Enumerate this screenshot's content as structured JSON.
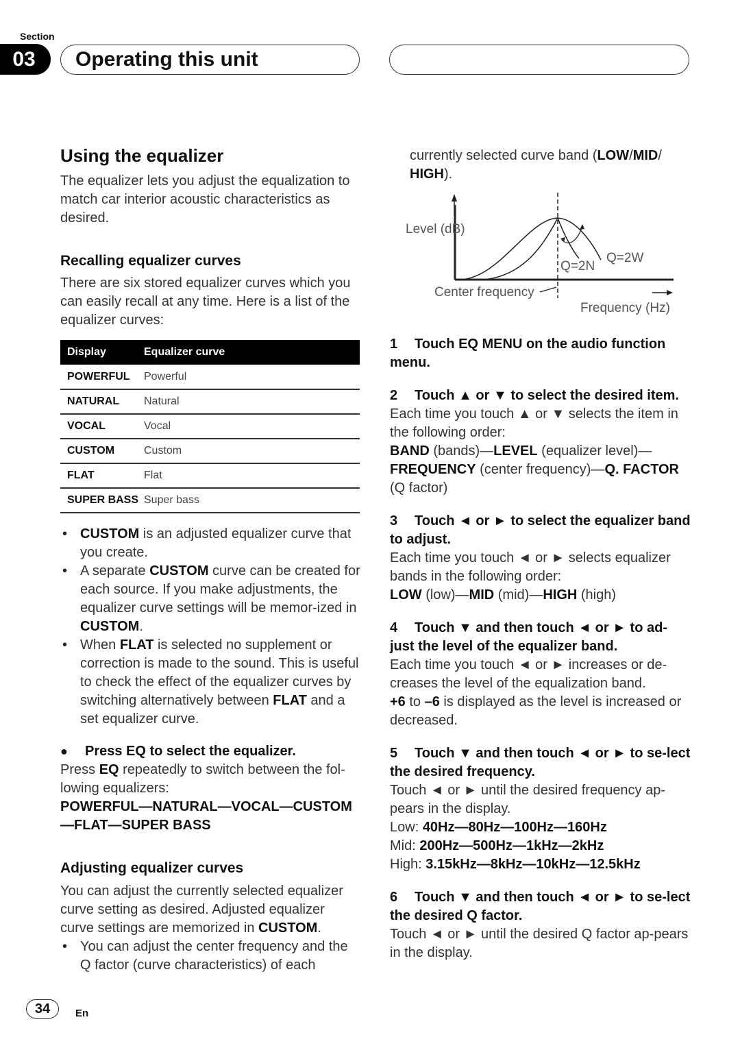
{
  "header": {
    "section_label": "Section",
    "section_number": "03",
    "title": "Operating this unit"
  },
  "left": {
    "heading": "Using the equalizer",
    "intro": "The equalizer lets you adjust the equalization to match car interior acoustic characteristics as desired.",
    "recall_heading": "Recalling equalizer curves",
    "recall_text": "There are six stored equalizer curves which you can easily recall at any time. Here is a list of the equalizer curves:",
    "table": {
      "headers": [
        "Display",
        "Equalizer curve"
      ],
      "rows": [
        {
          "display": "POWERFUL",
          "curve": "Powerful"
        },
        {
          "display": "NATURAL",
          "curve": "Natural"
        },
        {
          "display": "VOCAL",
          "curve": "Vocal"
        },
        {
          "display": "CUSTOM",
          "curve": "Custom"
        },
        {
          "display": "FLAT",
          "curve": "Flat"
        },
        {
          "display": "SUPER BASS",
          "curve": "Super bass"
        }
      ]
    },
    "bullets": [
      {
        "b1": "CUSTOM",
        "t1": " is an adjusted equalizer curve that you create."
      },
      {
        "t0": "A separate ",
        "b1": "CUSTOM",
        "t1": " curve can be created for each source. If you make adjustments, the equalizer curve settings will be memor-ized in ",
        "b2": "CUSTOM",
        "t2": "."
      },
      {
        "t0": "When ",
        "b1": "FLAT",
        "t1": " is selected no supplement or correction is made to the sound. This is useful to check the effect of the equalizer curves by switching alternatively between ",
        "b2": "FLAT",
        "t2": " and a set equalizer curve."
      }
    ],
    "press_eq": {
      "title": "Press EQ to select the equalizer.",
      "t0": "Press ",
      "b1": "EQ",
      "t1": " repeatedly to switch between the fol-lowing equalizers:",
      "sequence_line1": "POWERFUL—NATURAL—VOCAL—CUSTOM",
      "sequence_line2": "—FLAT—SUPER BASS"
    },
    "adjust_heading": "Adjusting equalizer curves",
    "adjust_t0": "You can adjust the currently selected equalizer curve setting as desired. Adjusted equalizer curve settings are memorized in ",
    "adjust_b1": "CUSTOM",
    "adjust_t1": ".",
    "adjust_bullet": "You can adjust the center frequency and the Q factor (curve characteristics) of each"
  },
  "right": {
    "cont_t0": "currently selected curve band (",
    "cont_b1": "LOW",
    "cont_s1": "/",
    "cont_b2": "MID",
    "cont_s2": "/ ",
    "cont_b3": "HIGH",
    "cont_t1": ").",
    "diagram": {
      "level_label": "Level (dB)",
      "q_narrow": "Q=2N",
      "q_wide": "Q=2W",
      "center_label": "Center frequency",
      "freq_label": "Frequency (Hz)"
    },
    "steps": [
      {
        "num": "1",
        "title": "Touch EQ MENU on the audio function menu."
      },
      {
        "num": "2",
        "title": "Touch ▲ or ▼ to select the desired item.",
        "body": "Each time you touch ▲ or ▼ selects the item in the following order:",
        "order": [
          {
            "b": "BAND",
            "t": " (bands)—"
          },
          {
            "b": "LEVEL",
            "t": " (equalizer level)—"
          },
          {
            "b": "FREQUENCY",
            "t": " (center frequency)—"
          },
          {
            "b": "Q. FACTOR",
            "t": " (Q factor)"
          }
        ]
      },
      {
        "num": "3",
        "title": "Touch ◄ or ► to select the equalizer band to adjust.",
        "body": "Each time you touch ◄ or ► selects equalizer bands in the following order:",
        "order": [
          {
            "b": "LOW",
            "t": " (low)—"
          },
          {
            "b": "MID",
            "t": " (mid)—"
          },
          {
            "b": "HIGH",
            "t": " (high)"
          }
        ]
      },
      {
        "num": "4",
        "title": "Touch ▼ and then touch ◄ or ► to ad-just the level of the equalizer band.",
        "body": "Each time you touch ◄ or ► increases or de-creases the level of the equalization band.",
        "range_b1": "+6",
        "range_t1": " to ",
        "range_b2": "–6",
        "range_t2": " is displayed as the level is increased or decreased."
      },
      {
        "num": "5",
        "title": "Touch ▼ and then touch ◄ or ► to se-lect the desired frequency.",
        "body": "Touch ◄ or ► until the desired frequency ap-pears in the display.",
        "freqs": [
          {
            "label": "Low: ",
            "values": "40Hz—80Hz—100Hz—160Hz"
          },
          {
            "label": "Mid: ",
            "values": "200Hz—500Hz—1kHz—2kHz"
          },
          {
            "label": "High: ",
            "values": "3.15kHz—8kHz—10kHz—12.5kHz"
          }
        ]
      },
      {
        "num": "6",
        "title": "Touch ▼ and then touch ◄ or ► to se-lect the desired Q factor.",
        "body": "Touch ◄ or ► until the desired Q factor ap-pears in the display."
      }
    ]
  },
  "footer": {
    "page_number": "34",
    "language": "En"
  }
}
